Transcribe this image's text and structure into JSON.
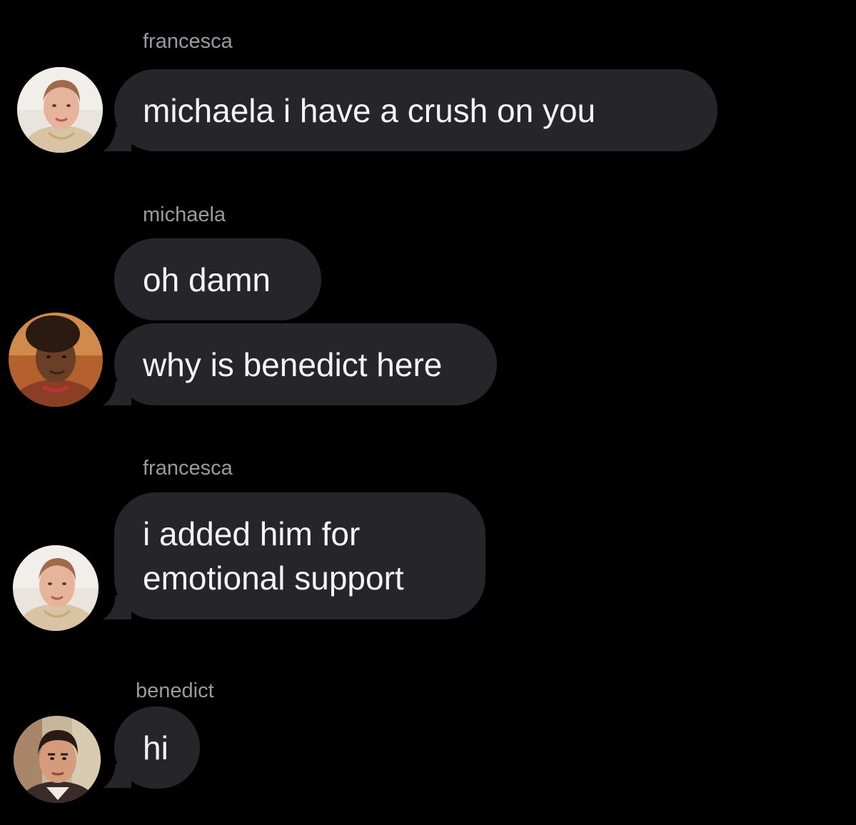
{
  "thread": {
    "messages": [
      {
        "sender": "francesca",
        "text": "michaela i have a crush on you"
      },
      {
        "sender": "michaela",
        "text": "oh damn"
      },
      {
        "sender": "michaela",
        "text": "why is benedict here"
      },
      {
        "sender": "francesca",
        "line1": "i added him for",
        "line2": "emotional support"
      },
      {
        "sender": "benedict",
        "text": "hi"
      }
    ]
  },
  "avatars": {
    "francesca": "francesca-avatar",
    "michaela": "michaela-avatar",
    "benedict": "benedict-avatar"
  },
  "colors": {
    "background": "#000000",
    "bubble": "#26252a",
    "bubble_text": "#f4f4f6",
    "sender_label": "#9a9a9f"
  }
}
